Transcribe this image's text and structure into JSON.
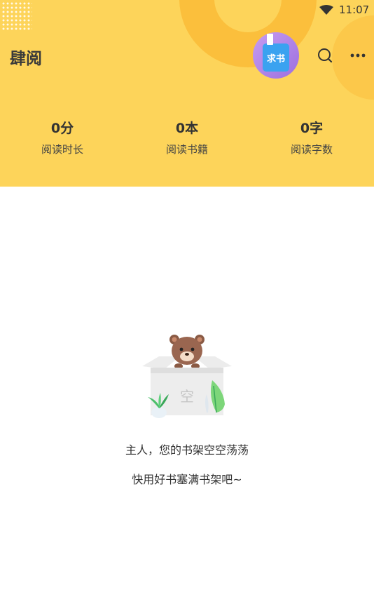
{
  "status_bar": {
    "time": "11:07",
    "wifi_icon": "wifi-icon"
  },
  "header": {
    "title": "肆阅",
    "request_book_label": "求书",
    "search_icon": "search-icon",
    "more_icon": "more-icon"
  },
  "stats": [
    {
      "value": "0分",
      "label": "阅读时长"
    },
    {
      "value": "0本",
      "label": "阅读书籍"
    },
    {
      "value": "0字",
      "label": "阅读字数"
    }
  ],
  "empty_state": {
    "box_label": "空",
    "line1": "主人，您的书架空空荡荡",
    "line2": "快用好书塞满书架吧~"
  },
  "colors": {
    "header_bg": "#fdd45a",
    "accent_ring": "#fbbf3c",
    "request_button": "#9c6fe0",
    "book_blue": "#3aa2f0"
  }
}
